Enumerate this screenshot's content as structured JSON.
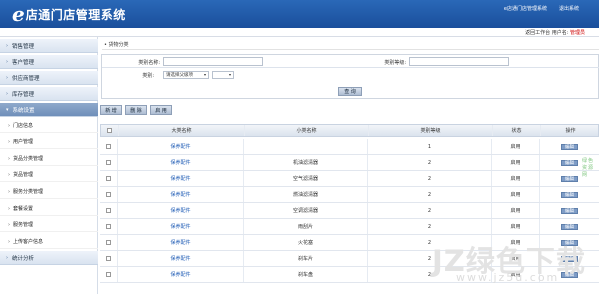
{
  "header": {
    "logo_e": "e",
    "logo_text": "店通门店管理系统",
    "system_link": "e店通门店管理系统",
    "logout_link": "退出系统"
  },
  "userbar": {
    "prefix": "返回工作台 用户名:",
    "role": "管理员"
  },
  "sidebar": {
    "top_items": [
      {
        "label": "销售管理"
      },
      {
        "label": "客户管理"
      },
      {
        "label": "供应商管理"
      },
      {
        "label": "库存管理"
      },
      {
        "label": "系统设置"
      }
    ],
    "sub_items": [
      {
        "label": "门店信息"
      },
      {
        "label": "用户管理"
      },
      {
        "label": "货品分类管理"
      },
      {
        "label": "货品管理"
      },
      {
        "label": "服务分类管理"
      },
      {
        "label": "套餐设置"
      },
      {
        "label": "服务管理"
      },
      {
        "label": "上传客户信息"
      }
    ],
    "bottom_item": {
      "label": "统计分析"
    }
  },
  "breadcrumb": "• 货物分类",
  "search_form": {
    "category_name_label": "类别名称:",
    "category_level_label": "类别等级:",
    "category_label": "类别:",
    "parent_select_value": "请选择父级项",
    "child_select_value": "",
    "query_button": "查 询"
  },
  "toolbar": {
    "add": "新 增",
    "delete": "删 除",
    "enable": "启 用"
  },
  "table": {
    "headers": [
      "大类名称",
      "小类名称",
      "类别等级",
      "状态",
      "操作"
    ],
    "rows": [
      {
        "major": "保养配件",
        "minor": "",
        "level": "1",
        "status": "启用",
        "action": "编辑"
      },
      {
        "major": "保养配件",
        "minor": "机油滤清器",
        "level": "2",
        "status": "启用",
        "action": "编辑"
      },
      {
        "major": "保养配件",
        "minor": "空气滤清器",
        "level": "2",
        "status": "启用",
        "action": "编辑"
      },
      {
        "major": "保养配件",
        "minor": "燃油滤清器",
        "level": "2",
        "status": "启用",
        "action": "编辑"
      },
      {
        "major": "保养配件",
        "minor": "空调滤清器",
        "level": "2",
        "status": "启用",
        "action": "编辑"
      },
      {
        "major": "保养配件",
        "minor": "雨刮片",
        "level": "2",
        "status": "启用",
        "action": "编辑"
      },
      {
        "major": "保养配件",
        "minor": "火花塞",
        "level": "2",
        "status": "启用",
        "action": "编辑"
      },
      {
        "major": "保养配件",
        "minor": "刹车片",
        "level": "2",
        "status": "启用",
        "action": "编辑"
      },
      {
        "major": "保养配件",
        "minor": "刹车盘",
        "level": "2",
        "status": "启用",
        "action": "编辑"
      }
    ]
  },
  "watermark": {
    "green_text": "绿色资源网",
    "big_text": "JZ绿色下载",
    "url_text": "www.jz5u.com"
  }
}
